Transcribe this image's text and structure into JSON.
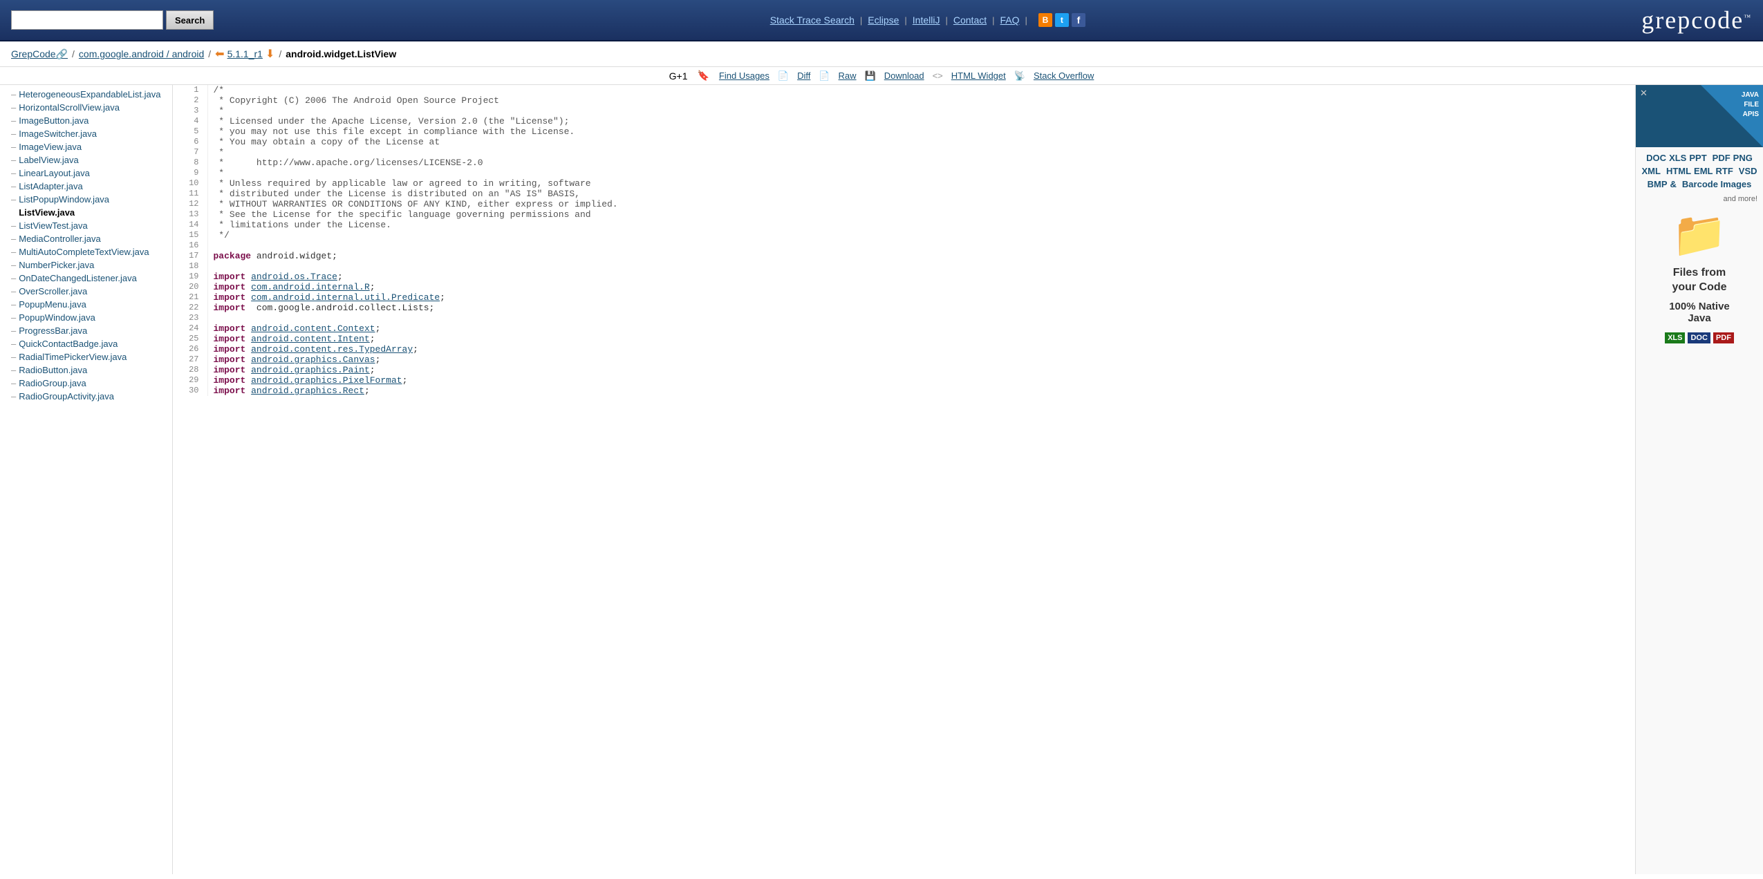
{
  "header": {
    "search_placeholder": "",
    "search_button": "Search",
    "nav": {
      "stack_trace": "Stack Trace Search",
      "eclipse": "Eclipse",
      "intellij": "IntelliJ",
      "contact": "Contact",
      "faq": "FAQ"
    },
    "logo": "grepcode"
  },
  "breadcrumb": {
    "grepcode": "GrepCode",
    "com_google": "com.google.android / android",
    "version": "5.1.1_r1",
    "file": "android.widget.ListView"
  },
  "actions": {
    "find_usages": "Find Usages",
    "diff": "Diff",
    "raw": "Raw",
    "download": "Download",
    "html_widget": "HTML Widget",
    "stack_overflow": "Stack Overflow"
  },
  "sidebar": {
    "items": [
      "HeterogeneousExpandableList.java",
      "HorizontalScrollView.java",
      "ImageButton.java",
      "ImageSwitcher.java",
      "ImageView.java",
      "LabelView.java",
      "LinearLayout.java",
      "ListAdapter.java",
      "ListPopupWindow.java",
      "ListView.java",
      "ListViewTest.java",
      "MediaController.java",
      "MultiAutoCompleteTextView.java",
      "NumberPicker.java",
      "OnDateChangedListener.java",
      "OverScroller.java",
      "PopupMenu.java",
      "PopupWindow.java",
      "ProgressBar.java",
      "QuickContactBadge.java",
      "RadialTimePickerView.java",
      "RadioButton.java",
      "RadioGroup.java",
      "RadioGroupActivity.java"
    ],
    "active_index": 9
  },
  "code": {
    "lines": [
      {
        "num": 1,
        "text": "/*",
        "type": "comment"
      },
      {
        "num": 2,
        "text": " * Copyright (C) 2006 The Android Open Source Project",
        "type": "comment"
      },
      {
        "num": 3,
        "text": " *",
        "type": "comment"
      },
      {
        "num": 4,
        "text": " * Licensed under the Apache License, Version 2.0 (the \"License\");",
        "type": "comment"
      },
      {
        "num": 5,
        "text": " * you may not use this file except in compliance with the License.",
        "type": "comment"
      },
      {
        "num": 6,
        "text": " * You may obtain a copy of the License at",
        "type": "comment"
      },
      {
        "num": 7,
        "text": " *",
        "type": "comment"
      },
      {
        "num": 8,
        "text": " *      http://www.apache.org/licenses/LICENSE-2.0",
        "type": "comment"
      },
      {
        "num": 9,
        "text": " *",
        "type": "comment"
      },
      {
        "num": 10,
        "text": " * Unless required by applicable law or agreed to in writing, software",
        "type": "comment"
      },
      {
        "num": 11,
        "text": " * distributed under the License is distributed on an \"AS IS\" BASIS,",
        "type": "comment"
      },
      {
        "num": 12,
        "text": " * WITHOUT WARRANTIES OR CONDITIONS OF ANY KIND, either express or implied.",
        "type": "comment"
      },
      {
        "num": 13,
        "text": " * See the License for the specific language governing permissions and",
        "type": "comment"
      },
      {
        "num": 14,
        "text": " * limitations under the License.",
        "type": "comment"
      },
      {
        "num": 15,
        "text": " */",
        "type": "comment"
      },
      {
        "num": 16,
        "text": "",
        "type": "blank"
      },
      {
        "num": 17,
        "text": "package android.widget;",
        "type": "package"
      },
      {
        "num": 18,
        "text": "",
        "type": "blank"
      },
      {
        "num": 19,
        "text": "import android.os.Trace;",
        "type": "import",
        "link": "android.os.Trace"
      },
      {
        "num": 20,
        "text": "import com.android.internal.R;",
        "type": "import",
        "link": "com.android.internal.R"
      },
      {
        "num": 21,
        "text": "import com.android.internal.util.Predicate;",
        "type": "import",
        "link": "com.android.internal.util.Predicate"
      },
      {
        "num": 22,
        "text": "import  com.google.android.collect.Lists;",
        "type": "import-plain"
      },
      {
        "num": 23,
        "text": "",
        "type": "blank"
      },
      {
        "num": 24,
        "text": "import android.content.Context;",
        "type": "import",
        "link": "android.content.Context"
      },
      {
        "num": 25,
        "text": "import android.content.Intent;",
        "type": "import",
        "link": "android.content.Intent"
      },
      {
        "num": 26,
        "text": "import android.content.res.TypedArray;",
        "type": "import",
        "link": "android.content.res.TypedArray"
      },
      {
        "num": 27,
        "text": "import android.graphics.Canvas;",
        "type": "import",
        "link": "android.graphics.Canvas"
      },
      {
        "num": 28,
        "text": "import android.graphics.Paint;",
        "type": "import",
        "link": "android.graphics.Paint"
      },
      {
        "num": 29,
        "text": "import android.graphics.PixelFormat;",
        "type": "import",
        "link": "android.graphics.PixelFormat"
      },
      {
        "num": 30,
        "text": "import android.graphics.Rect;",
        "type": "import",
        "link": "android.graphics.Rect"
      }
    ]
  },
  "ad": {
    "corner_text": "JAVA\nFILE\nAPIS",
    "close": "✕",
    "formats": [
      "DOC",
      "XLS",
      "PPT",
      "PDF",
      "PNG",
      "XML",
      "HTML",
      "EML",
      "RTF",
      "VSD",
      "BMP",
      "&",
      "Barcode Images"
    ],
    "headline": "Files from\nyour Code",
    "subheadline": "100% Native\nJava",
    "bottom_formats": [
      "XLS",
      "DOC",
      "PDF"
    ]
  }
}
